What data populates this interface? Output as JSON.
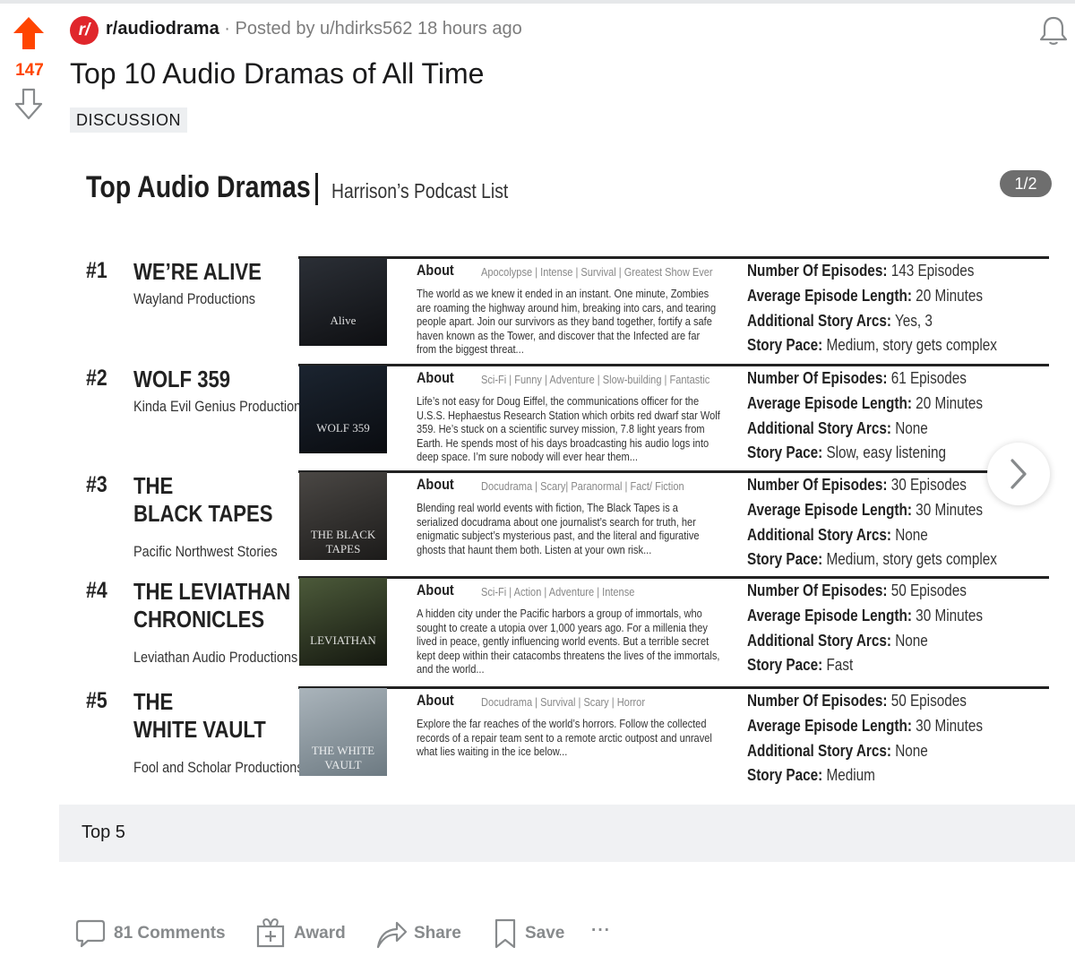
{
  "vote": {
    "score": "147"
  },
  "header": {
    "sub_icon": "r/",
    "subreddit": "r/audiodrama",
    "separator": "·",
    "posted_by": "Posted by u/hdirks562",
    "time": "18 hours ago",
    "title": "Top 10 Audio Dramas of All Time",
    "flair": "DISCUSSION"
  },
  "gallery": {
    "title": "Top Audio Dramas",
    "subtitle": "Harrison’s Podcast List",
    "counter": "1/2",
    "caption": "Top 5",
    "entries": [
      {
        "rank": "#1",
        "name_lines": [
          "WE’RE ALIVE"
        ],
        "producer": "Wayland Productions",
        "cover_text": "Alive",
        "cover_colors": [
          "#2b2f36",
          "#0e0f12"
        ],
        "about": "About",
        "tags": "Apocolypse | Intense | Survival | Greatest Show Ever",
        "description": "The world as we knew it ended in an instant. One minute, Zombies are roaming the highway around him, breaking into cars, and tearing people apart. Join our survivors as they band together, fortify a safe haven known as the Tower, and discover that the Infected are far from the biggest threat...",
        "stats": [
          {
            "label": "Number Of Episodes:",
            "value": "143 Episodes"
          },
          {
            "label": "Average Episode Length:",
            "value": "20 Minutes"
          },
          {
            "label": "Additional Story Arcs:",
            "value": "Yes, 3"
          },
          {
            "label": "Story Pace:",
            "value": "Medium, story gets complex"
          }
        ]
      },
      {
        "rank": "#2",
        "name_lines": [
          "WOLF 359"
        ],
        "producer": "Kinda Evil Genius Productions",
        "cover_text": "WOLF 359",
        "cover_colors": [
          "#1b2430",
          "#0a0c10"
        ],
        "about": "About",
        "tags": "Sci-Fi | Funny | Adventure | Slow-building | Fantastic",
        "description": "Life’s not easy for Doug Eiffel, the communications officer for the U.S.S. Hephaestus Research Station which orbits red dwarf star Wolf 359. He’s stuck on a scientific survey mission, 7.8 light years from Earth. He spends most of his days broadcasting his audio logs into deep space. I’m sure nobody will ever hear them...",
        "stats": [
          {
            "label": "Number Of Episodes:",
            "value": "61 Episodes"
          },
          {
            "label": "Average Episode Length:",
            "value": "20 Minutes"
          },
          {
            "label": "Additional Story Arcs:",
            "value": "None"
          },
          {
            "label": "Story Pace:",
            "value": "Slow, easy listening"
          }
        ]
      },
      {
        "rank": "#3",
        "name_lines": [
          "THE",
          "BLACK TAPES"
        ],
        "producer": "Pacific Northwest Stories",
        "cover_text": "THE BLACK TAPES",
        "cover_colors": [
          "#4a4744",
          "#1c1b1a"
        ],
        "about": "About",
        "tags": "Docudrama | Scary| Paranormal | Fact/ Fiction",
        "description": "Blending real world events with fiction, The Black Tapes is a serialized docudrama about one journalist’s search for truth, her enigmatic subject’s mysterious past, and the literal and figurative ghosts that haunt them both. Listen at your own risk...",
        "stats": [
          {
            "label": "Number Of Episodes:",
            "value": "30 Episodes"
          },
          {
            "label": "Average Episode Length:",
            "value": "30 Minutes"
          },
          {
            "label": "Additional Story Arcs:",
            "value": "None"
          },
          {
            "label": "Story Pace:",
            "value": "Medium, story gets complex"
          }
        ]
      },
      {
        "rank": "#4",
        "name_lines": [
          "THE LEVIATHAN",
          "CHRONICLES"
        ],
        "producer": "Leviathan Audio Productions",
        "cover_text": "LEVIATHAN",
        "cover_colors": [
          "#4c5a3a",
          "#14170f"
        ],
        "about": "About",
        "tags": "Sci-Fi | Action | Adventure | Intense",
        "description": "A hidden city under the Pacific harbors a group of immortals, who sought to create a utopia over 1,000 years ago. For a millenia they lived in peace, gently influencing world events. But a terrible secret kept deep within their catacombs threatens the lives of the immortals, and the world...",
        "stats": [
          {
            "label": "Number Of Episodes:",
            "value": "50 Episodes"
          },
          {
            "label": "Average Episode Length:",
            "value": "30 Minutes"
          },
          {
            "label": "Additional Story Arcs:",
            "value": "None"
          },
          {
            "label": "Story Pace:",
            "value": "Fast"
          }
        ]
      },
      {
        "rank": "#5",
        "name_lines": [
          "THE",
          "WHITE VAULT"
        ],
        "producer": "Fool and Scholar Productions",
        "cover_text": "THE WHITE VAULT",
        "cover_colors": [
          "#aab4bb",
          "#6d7a82"
        ],
        "about": "About",
        "tags": "Docudrama | Survival | Scary | Horror",
        "description": "Explore the far reaches of the world’s horrors. Follow the collected records of a repair team sent to a remote arctic outpost and unravel what lies waiting in the ice below...",
        "stats": [
          {
            "label": "Number Of Episodes:",
            "value": "50 Episodes"
          },
          {
            "label": "Average Episode Length:",
            "value": "30 Minutes"
          },
          {
            "label": "Additional Story Arcs:",
            "value": "None"
          },
          {
            "label": "Story Pace:",
            "value": "Medium"
          }
        ]
      }
    ]
  },
  "actions": {
    "comments": "81 Comments",
    "award": "Award",
    "share": "Share",
    "save": "Save",
    "more": "···"
  },
  "colors": {
    "upvote": "#ff4500",
    "score": "#ff4500",
    "subreddit_icon": "#e0262b",
    "action_text": "#878a8c"
  },
  "icons": [
    "upvote-arrow-icon",
    "downvote-arrow-icon",
    "bell-icon",
    "chevron-right-icon",
    "comment-icon",
    "award-icon",
    "share-icon",
    "bookmark-icon",
    "more-icon"
  ]
}
